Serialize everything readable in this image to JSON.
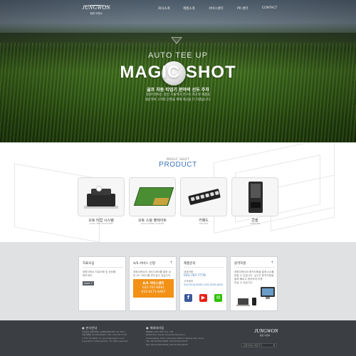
{
  "brand": {
    "logo_mark": "JUNGWON",
    "logo_sub": "정원 이엔씨"
  },
  "nav": [
    "회사소개",
    "제품소개",
    "서비스센터",
    "PR 센터",
    "CONTACT"
  ],
  "hero": {
    "subtitle": "AUTO TEE UP",
    "title": "MAGIC SHOT",
    "line1": "골프 자동 티업기 분야의 선두 주자",
    "line2": "정원이엔씨는 앞선 기술력과 연구로 최고의 제품을",
    "line3": "생산하며 고객의 만족을 위해 최선을 다 하겠습니다."
  },
  "product_section": {
    "eyebrow": "MAGIC SHOT",
    "title": "PRODUCT",
    "items": [
      {
        "name": "오토 티업 시스템",
        "sub": "AUTO TEE UP SYSTEM"
      },
      {
        "name": "오토 스윙 플레이트",
        "sub": "AUTO SWING SYSTEM"
      },
      {
        "name": "키패드",
        "sub": "KEY PAD"
      },
      {
        "name": "콘솔",
        "sub": "CONSOLE"
      }
    ]
  },
  "info": {
    "notice": {
      "title": "자료모음",
      "text": [
        "정원이엔씨 자료모음 및 정보를",
        "용하세요."
      ],
      "button": "more +"
    },
    "as": {
      "title": "A/S 서비스 신청",
      "text": [
        "정원이엔씨의 서비스센터를 통한 상",
        "담 AS 서비스를 받으실수 있습니다."
      ],
      "box_title": "A/S 서비스센터",
      "phone1": "031-767-8061",
      "phone2": "010-4171-6467"
    },
    "contact": {
      "title": "제품문의",
      "label1": "대표전화",
      "phone": "031-767-7776",
      "label2": "고객센터",
      "phone2": "010.3114.4090 / 010.3125.6222"
    },
    "remote": {
      "title": "원격지원",
      "text": [
        "정원이엔씨의 원격지원을 통해 A/S를",
        "받을 수 있습니다. 실시간 원격지원을",
        "통해 빠르고 편리하게 이용",
        "하실 수 있습니다."
      ]
    }
  },
  "footer": {
    "col1": {
      "title": "본사안내",
      "lines": [
        "주식회사 정원이엔씨 (JUNGWON ENC CO.,LTD.)",
        "사업자번호 123-86-00000 | TEL: 031-767-7776",
        "F. 031-767-8061 | E. jwenc@jungwon.co.kr",
        "Copyright © 2016 jwmsdc. All rights reserved."
      ]
    },
    "col2": {
      "title": "해외대리점",
      "lines": [
        "BEIJING OAK TECH CO., LTD",
        "ROOM 501, Kiwoel House Building No.1,",
        "Guokangzhou Road, Chaoyang District, Beijing City, China",
        "TEL: 86-10-6510-8665 | 86-10-6510-8236",
        "FAX: 86-10-6510-8203 | 86-10-6510-8203"
      ]
    },
    "logo_mark": "JUNGWON",
    "logo_sub": "정원 이엔씨",
    "select_label": "관련사이트 바로가기"
  }
}
